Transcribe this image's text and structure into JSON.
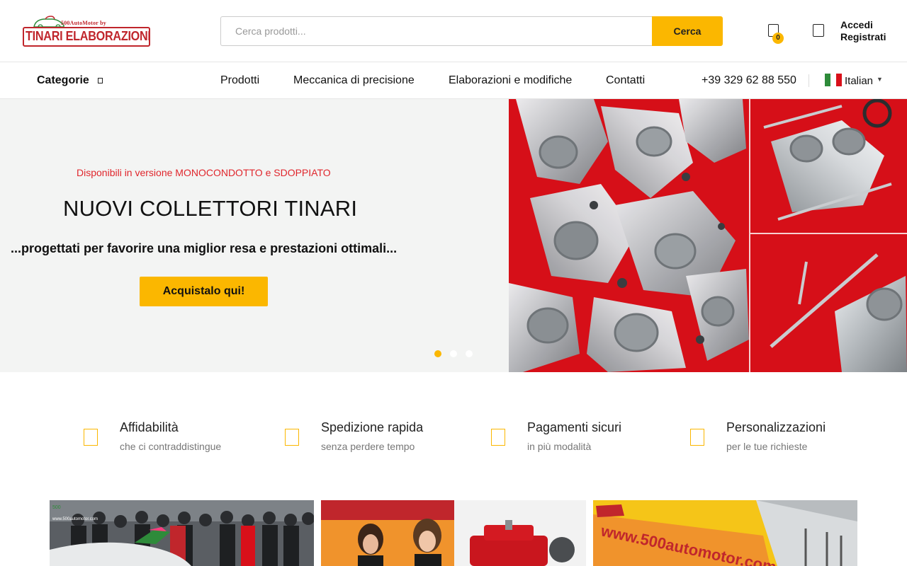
{
  "logo": {
    "top_line": "500AutoMotor by",
    "brand": "TINARI ELABORAZIONI"
  },
  "search": {
    "placeholder": "Cerca prodotti...",
    "button_label": "Cerca"
  },
  "cart": {
    "count": "0"
  },
  "account": {
    "login": "Accedi",
    "register": "Registrati"
  },
  "nav": {
    "categories_label": "Categorie",
    "menu": [
      "Prodotti",
      "Meccanica di precisione",
      "Elaborazioni e modifiche",
      "Contatti"
    ],
    "phone": "+39 329 62 88 550",
    "language": "Italian"
  },
  "hero": {
    "kicker": "Disponibili in versione MONOCONDOTTO e SDOPPIATO",
    "title": "NUOVI COLLETTORI TINARI",
    "subtitle": "...progettati per favorire una miglior resa e prestazioni ottimali...",
    "cta": "Acquistalo qui!",
    "slides_total": 3,
    "active_slide": 1
  },
  "features": [
    {
      "title": "Affidabilità",
      "sub": "che ci contraddistingue"
    },
    {
      "title": "Spedizione rapida",
      "sub": "senza perdere tempo"
    },
    {
      "title": "Pagamenti sicuri",
      "sub": "in più modalità"
    },
    {
      "title": "Personalizzazioni",
      "sub": "per le tue richieste"
    }
  ],
  "gallery": {
    "photo1_caption": "www.500automotor.com",
    "photo3_banner": "www.500automotor.com"
  },
  "colors": {
    "accent": "#fbb700",
    "brand_red": "#c0262c",
    "hero_red": "#d9101a"
  }
}
